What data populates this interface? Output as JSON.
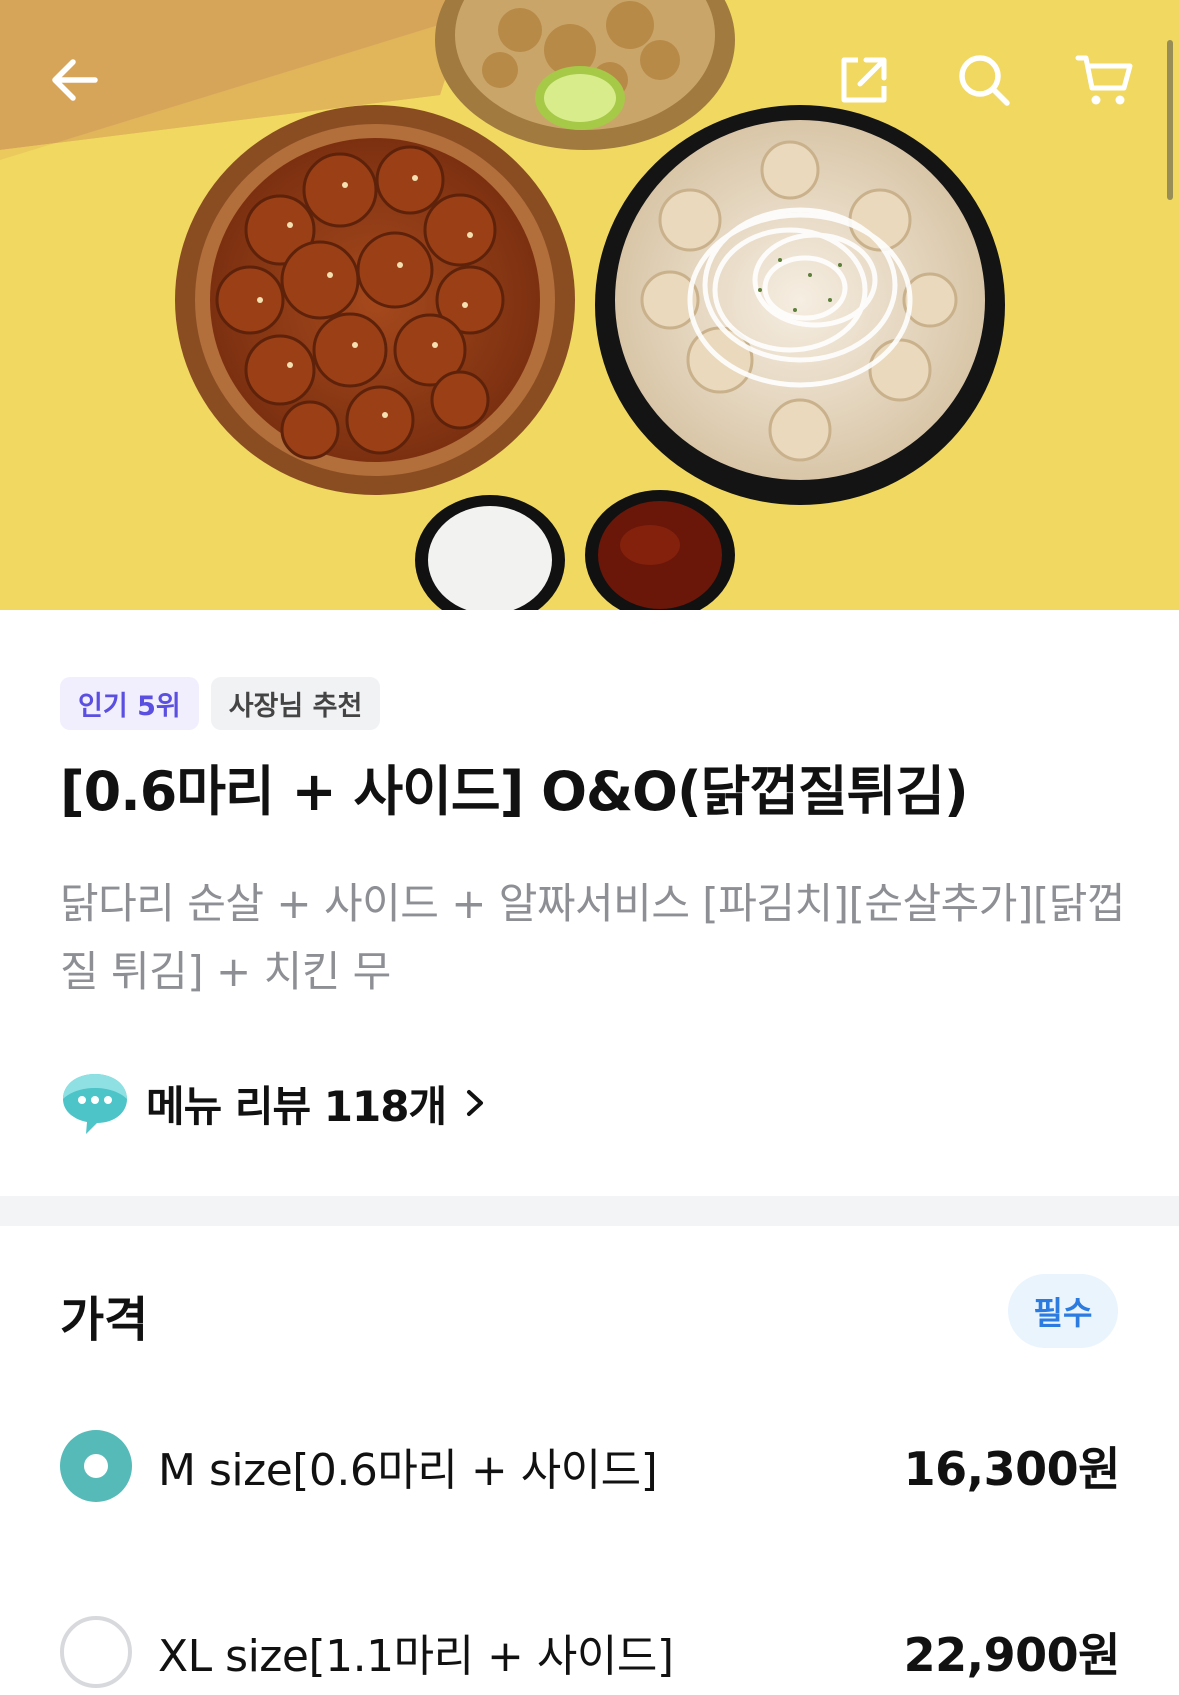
{
  "header": {
    "back_icon": "arrow-left-icon",
    "share_icon": "share-icon",
    "search_icon": "search-icon",
    "cart_icon": "cart-icon"
  },
  "hero": {
    "image": "fried chicken platter with sauces photo"
  },
  "badges": [
    {
      "label": "인기 5위",
      "color": "#5a4fe0"
    },
    {
      "label": "사장님 추천",
      "color": "#444444"
    }
  ],
  "menu": {
    "title": "[0.6마리 + 사이드] O&O(닭껍질튀김)",
    "description": "닭다리 순살 + 사이드 + 알짜서비스 [파김치][순살추가][닭껍질 튀김] + 치킨 무"
  },
  "review": {
    "icon": "chat-bubble-icon",
    "label": "메뉴 리뷰 118개",
    "chevron": "chevron-right-icon"
  },
  "price_section": {
    "title": "가격",
    "required_label": "필수",
    "options": [
      {
        "label": "M size[0.6마리 + 사이드]",
        "price": "16,300원",
        "selected": true
      },
      {
        "label": "XL size[1.1마리 + 사이드]",
        "price": "22,900원",
        "selected": false
      }
    ]
  },
  "colors": {
    "accent": "#55bab8",
    "required_text": "#2b7be0"
  }
}
